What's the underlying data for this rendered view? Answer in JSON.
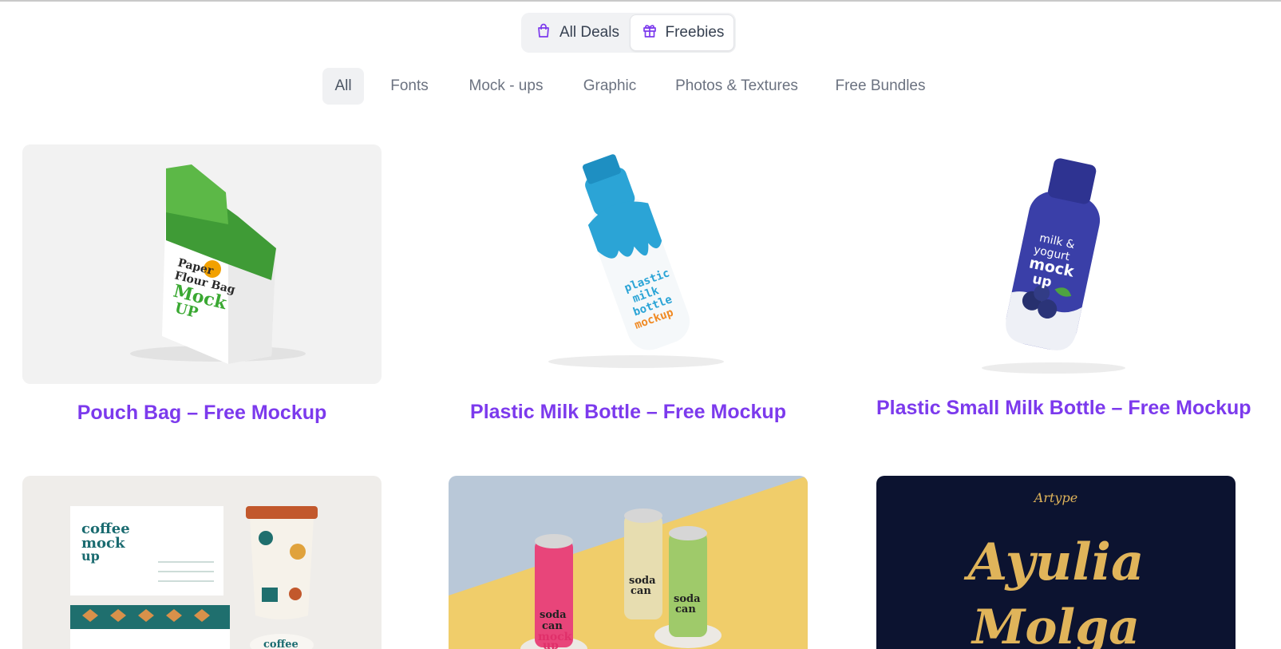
{
  "deal_switch": {
    "all_deals": {
      "label": "All Deals",
      "icon": "shopping-bag-icon"
    },
    "freebies": {
      "label": "Freebies",
      "icon": "gift-icon",
      "selected": true
    }
  },
  "categories": [
    {
      "label": "All",
      "active": true
    },
    {
      "label": "Fonts"
    },
    {
      "label": "Mock - ups"
    },
    {
      "label": "Graphic"
    },
    {
      "label": "Photos & Textures"
    },
    {
      "label": "Free Bundles"
    }
  ],
  "cards": [
    {
      "title": "Pouch Bag – Free Mockup",
      "image_text": [
        "Paper",
        "Flour Bag",
        "Mock",
        "UP"
      ]
    },
    {
      "title": "Plastic Milk Bottle – Free Mockup",
      "image_text": [
        "plastic",
        "milk",
        "bottle",
        "mockup"
      ]
    },
    {
      "title": "Plastic Small Milk Bottle – Free Mockup",
      "image_text": [
        "milk &",
        "yogurt",
        "mock",
        "up"
      ]
    },
    {
      "title": "",
      "image_text": [
        "coffee",
        "mock",
        "up"
      ]
    },
    {
      "title": "",
      "image_text": [
        "soda",
        "can",
        "mock",
        "up"
      ]
    },
    {
      "title": "",
      "image_text": [
        "Artype",
        "Ayulia",
        "Molga"
      ]
    }
  ],
  "colors": {
    "accent": "#7c3aed",
    "tab_text": "#6b7280",
    "switch_bg": "#f1f2f4"
  }
}
